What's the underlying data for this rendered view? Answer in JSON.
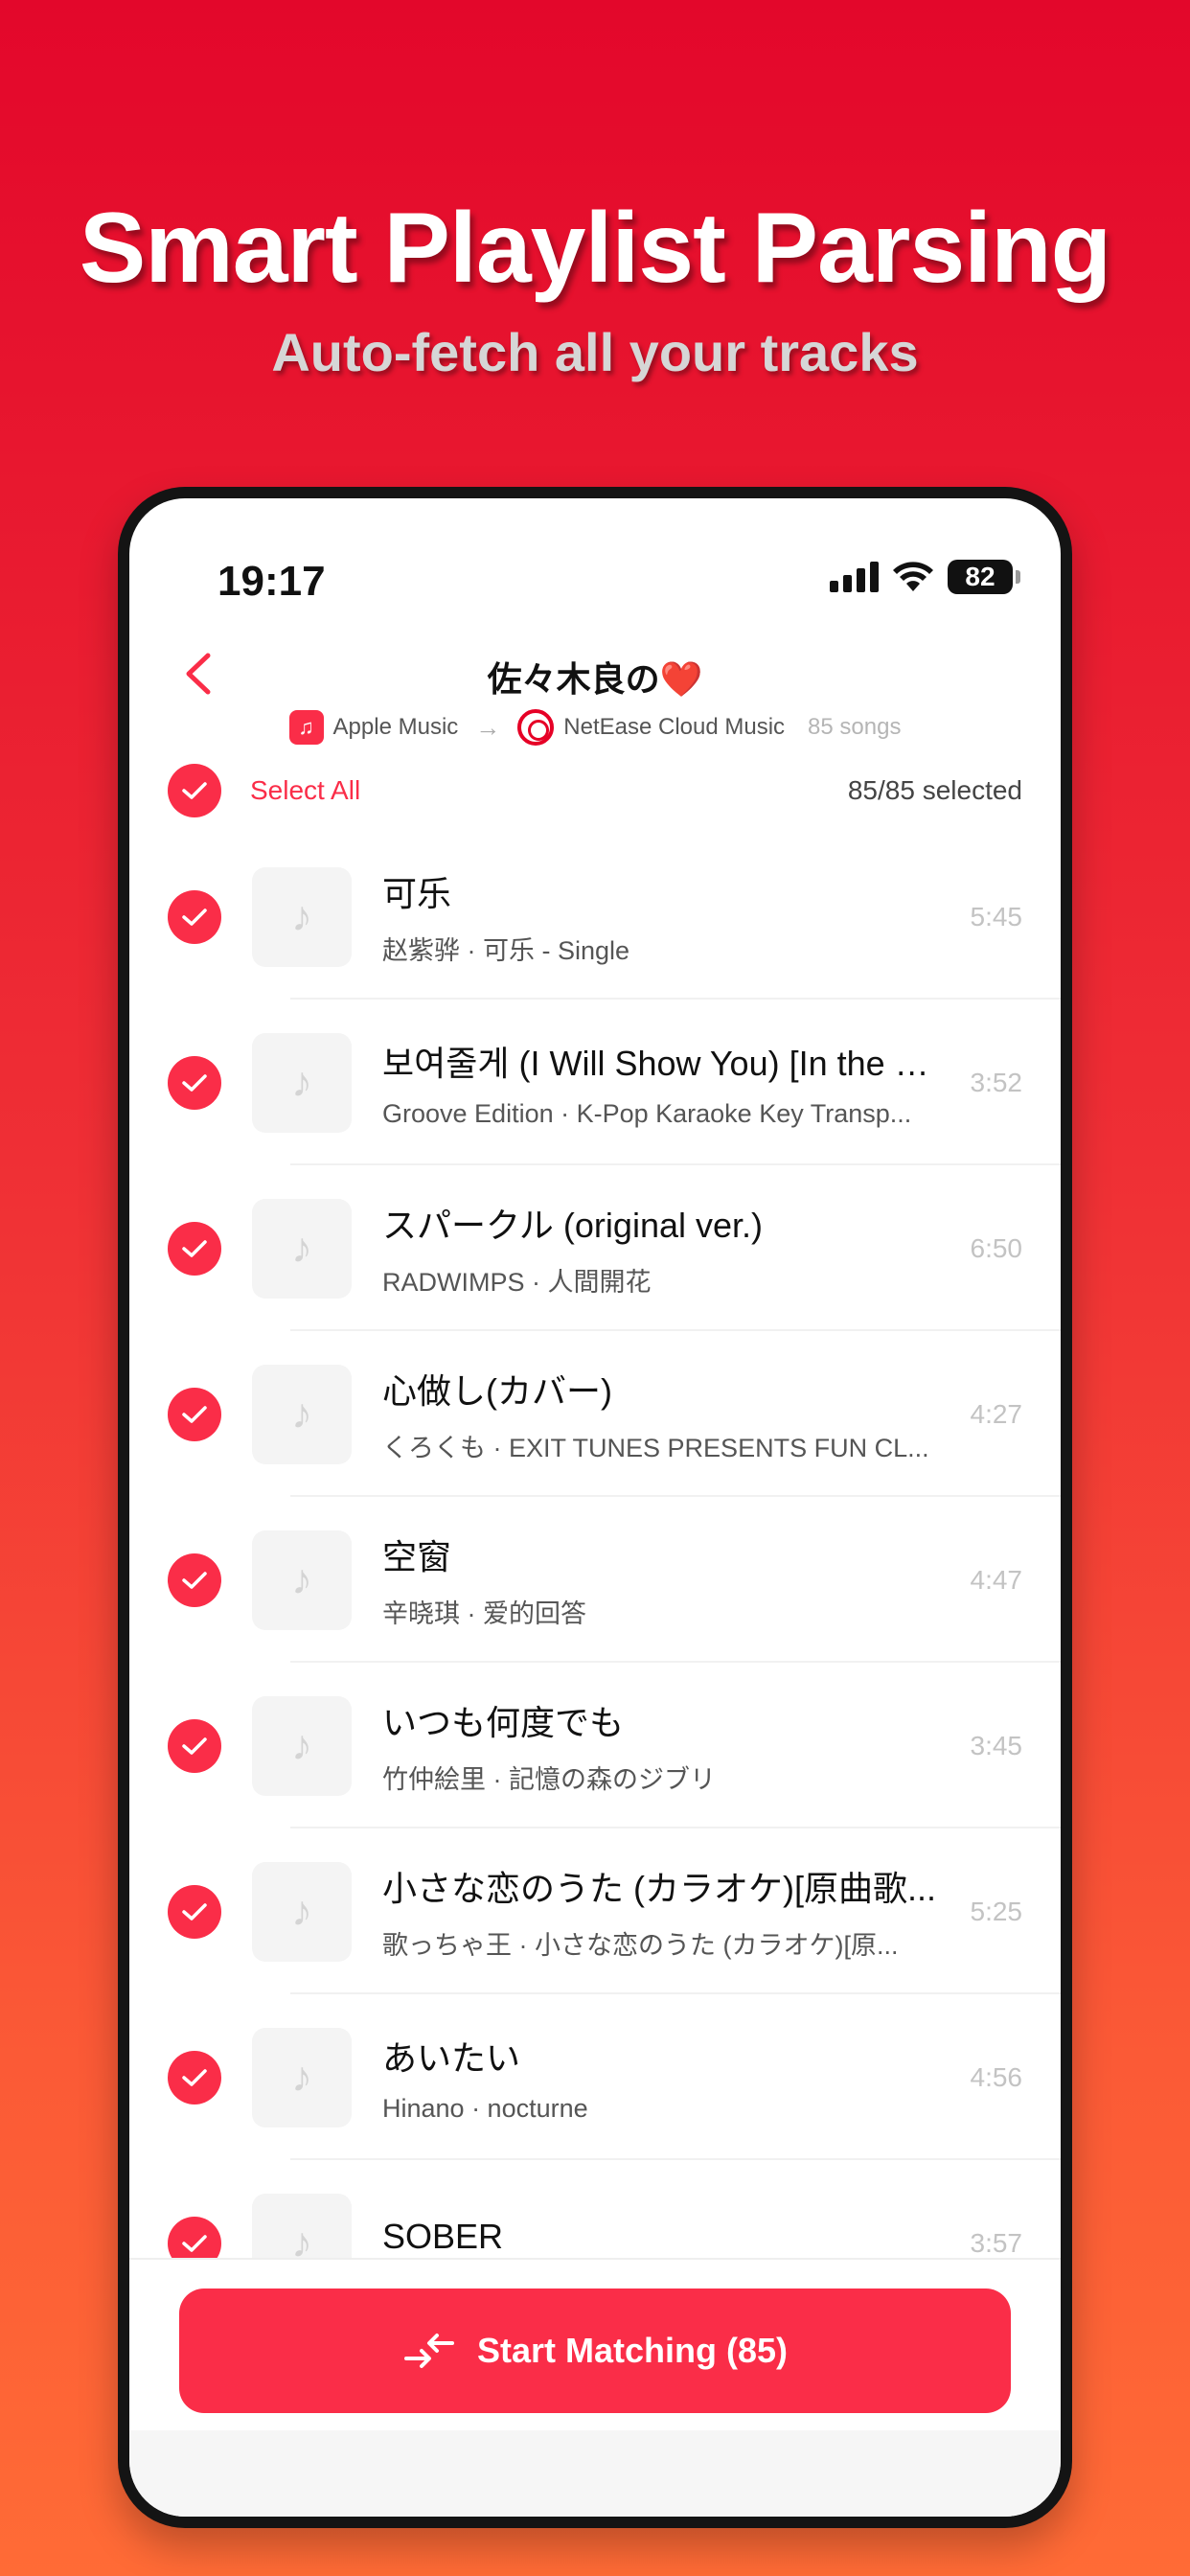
{
  "hero": {
    "title": "Smart Playlist Parsing",
    "subtitle": "Auto-fetch all your tracks"
  },
  "status_bar": {
    "time": "19:17",
    "battery": "82"
  },
  "nav": {
    "title": "佐々木良の❤️",
    "source": "Apple Music",
    "target": "NetEase Cloud Music",
    "song_count": "85 songs"
  },
  "selection": {
    "select_all_label": "Select All",
    "selected_count": "85/85 selected"
  },
  "tracks": [
    {
      "title": "可乐",
      "subtitle": "赵紫骅 · 可乐 - Single",
      "duration": "5:45"
    },
    {
      "title": "보여줄게 (I Will Show You) [In the S...",
      "subtitle": "Groove Edition · K-Pop Karaoke Key Transp...",
      "duration": "3:52"
    },
    {
      "title": "スパークル (original ver.)",
      "subtitle": "RADWIMPS · 人間開花",
      "duration": "6:50"
    },
    {
      "title": "心做し(カバー)",
      "subtitle": "くろくも · EXIT TUNES PRESENTS FUN CL...",
      "duration": "4:27"
    },
    {
      "title": "空窗",
      "subtitle": "辛晓琪 · 爱的回答",
      "duration": "4:47"
    },
    {
      "title": "いつも何度でも",
      "subtitle": "竹仲絵里 · 記憶の森のジブリ",
      "duration": "3:45"
    },
    {
      "title": "小さな恋のうた (カラオケ)[原曲歌...",
      "subtitle": "歌っちゃ王 · 小さな恋のうた (カラオケ)[原...",
      "duration": "5:25"
    },
    {
      "title": "あいたい",
      "subtitle": "Hinano · nocturne",
      "duration": "4:56"
    },
    {
      "title": "SOBER",
      "subtitle": "",
      "duration": "3:57"
    }
  ],
  "action": {
    "start_label": "Start Matching (85)"
  },
  "colors": {
    "accent": "#fa2d48",
    "netease": "#e60026"
  }
}
